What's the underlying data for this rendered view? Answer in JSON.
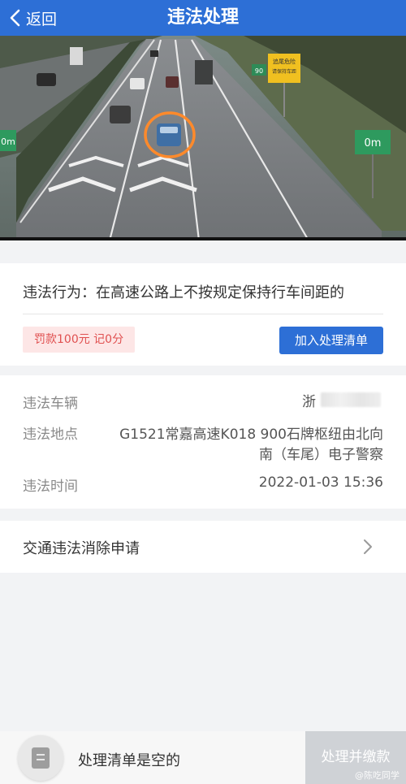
{
  "header": {
    "back_label": "返回",
    "title": "违法处理"
  },
  "photo": {
    "signs": [
      {
        "text": "0m"
      },
      {
        "text": "0m"
      },
      {
        "text": "90"
      },
      {
        "text": "追尾危险"
      },
      {
        "text": "请保持车距"
      }
    ]
  },
  "violation": {
    "behavior": "违法行为：在高速公路上不按规定保持行车间距的",
    "fine": "罚款100元 记0分",
    "add_button": "加入处理清单"
  },
  "details": {
    "vehicle_label": "违法车辆",
    "vehicle_value": "浙",
    "location_label": "违法地点",
    "location_line1": "G1521常嘉高速K018 900石牌枢纽由北向",
    "location_line2": "南（车尾）电子警察",
    "time_label": "违法时间",
    "time_value": "2022-01-03 15:36"
  },
  "appeal": {
    "label": "交通违法消除申请"
  },
  "bottom": {
    "empty_text": "处理清单是空的",
    "pay_button": "处理并缴款",
    "watermark": "@陈吃同学"
  },
  "colors": {
    "primary": "#2d6fd6",
    "fine_bg": "#fde6e6",
    "fine_text": "#e05050",
    "disabled": "#cfd2d6"
  },
  "icons": {
    "back": "chevron-left-icon",
    "chevron": "chevron-right-icon",
    "list": "list-document-icon"
  }
}
